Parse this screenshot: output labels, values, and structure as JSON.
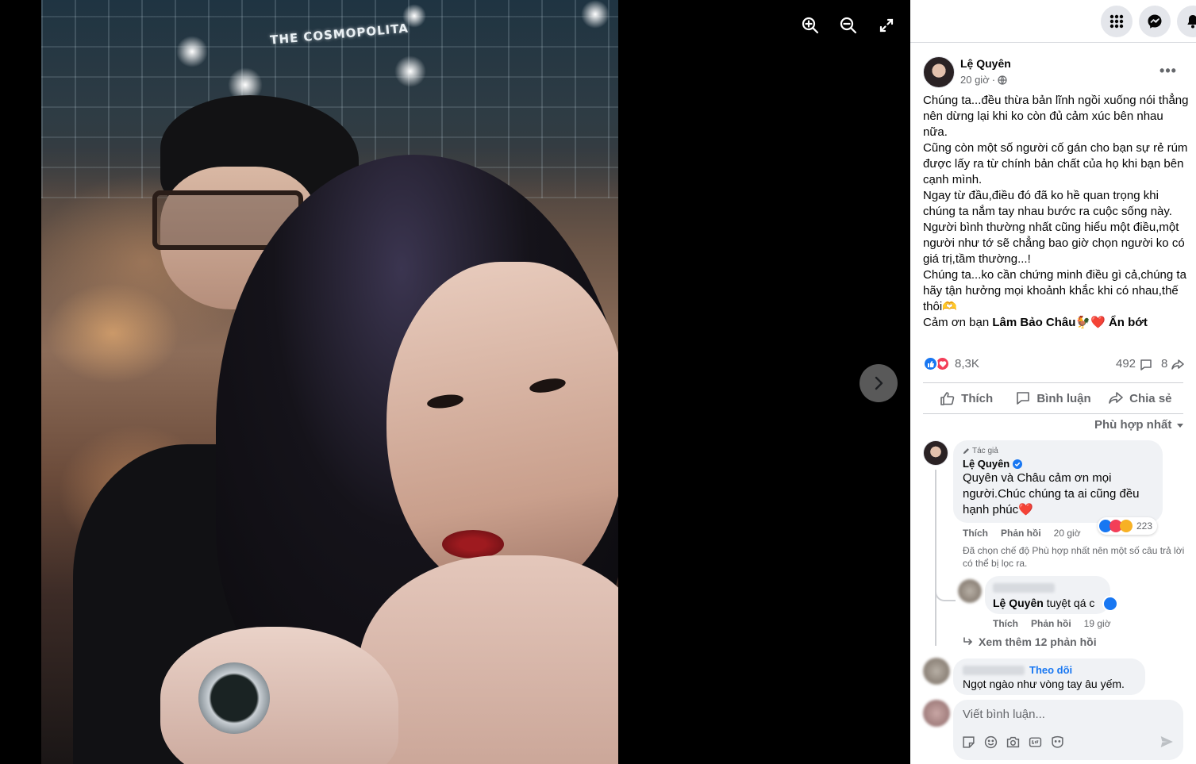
{
  "photo": {
    "sign_text": "THE COSMOPOLITA"
  },
  "viewer_controls": {
    "zoom_in": "zoom-in-icon",
    "zoom_out": "zoom-out-icon",
    "fullscreen": "fullscreen-icon",
    "next": "chevron-right-icon"
  },
  "topbar": {
    "icons": [
      "grid-menu-icon",
      "messenger-icon",
      "bell-icon"
    ]
  },
  "post": {
    "author": "Lệ Quyên",
    "time": "20 giờ",
    "privacy_icon": "globe-icon",
    "body": [
      "Chúng ta...đều thừa bản lĩnh ngồi xuống nói thẳng nên dừng lại khi ko còn đủ cảm xúc bên nhau nữa.",
      "Cũng còn một số người cố gán cho bạn sự rẻ rúm được lấy ra từ chính bản chất của họ khi bạn bên cạnh mình.",
      "Ngay từ đầu,điều đó đã ko hề quan trọng khi chúng ta nắm tay nhau bước ra cuộc sống này.",
      "Người bình thường nhất cũng hiểu một điều,một người như tớ sẽ chẳng bao giờ chọn người ko có giá trị,tầm thường...!",
      "Chúng ta...ko cần chứng minh điều gì cả,chúng ta hãy tận hưởng mọi khoảnh khắc khi có nhau,thế thôi🫶"
    ],
    "thanks_prefix": "Cảm ơn bạn",
    "tagged_name": "Lâm Bảo Châu",
    "thanks_emoji": "🐓❤️",
    "hide_label": "Ẩn bớt",
    "reaction_count": "8,3K",
    "comment_count": "492",
    "share_count": "8"
  },
  "actions": {
    "like": "Thích",
    "comment": "Bình luận",
    "share": "Chia sẻ"
  },
  "sort": {
    "label": "Phù hợp nhất"
  },
  "comments": {
    "author_badge": "Tác giả",
    "first": {
      "name": "Lệ Quyên",
      "text": "Quyên và Châu cảm ơn mọi người.Chúc chúng ta ai cũng đều hạnh phúc❤️",
      "like": "Thích",
      "reply": "Phản hồi",
      "time": "20 giờ",
      "reactions": "223"
    },
    "filter_note": "Đã chọn chế độ Phù hợp nhất nên một số câu trả lời có thể bị lọc ra.",
    "reply": {
      "mention": "Lệ Quyên",
      "text": "tuyệt qá c",
      "like": "Thích",
      "reply": "Phản hồi",
      "time": "19 giờ"
    },
    "more_replies": "Xem thêm 12 phản hồi",
    "second": {
      "follow": "Theo dõi",
      "text": "Ngọt ngào như vòng tay âu yếm."
    }
  },
  "composer": {
    "placeholder": "Viết bình luận...",
    "icons": [
      "sticker-icon",
      "emoji-icon",
      "camera-icon",
      "gif-icon",
      "avatar-sticker-icon"
    ],
    "send": "send-icon"
  },
  "colors": {
    "accent": "#1877f2",
    "like_blue": "#1877f2",
    "love_red": "#f33e58",
    "text_secondary": "#65676b",
    "bubble": "#f0f2f5"
  }
}
